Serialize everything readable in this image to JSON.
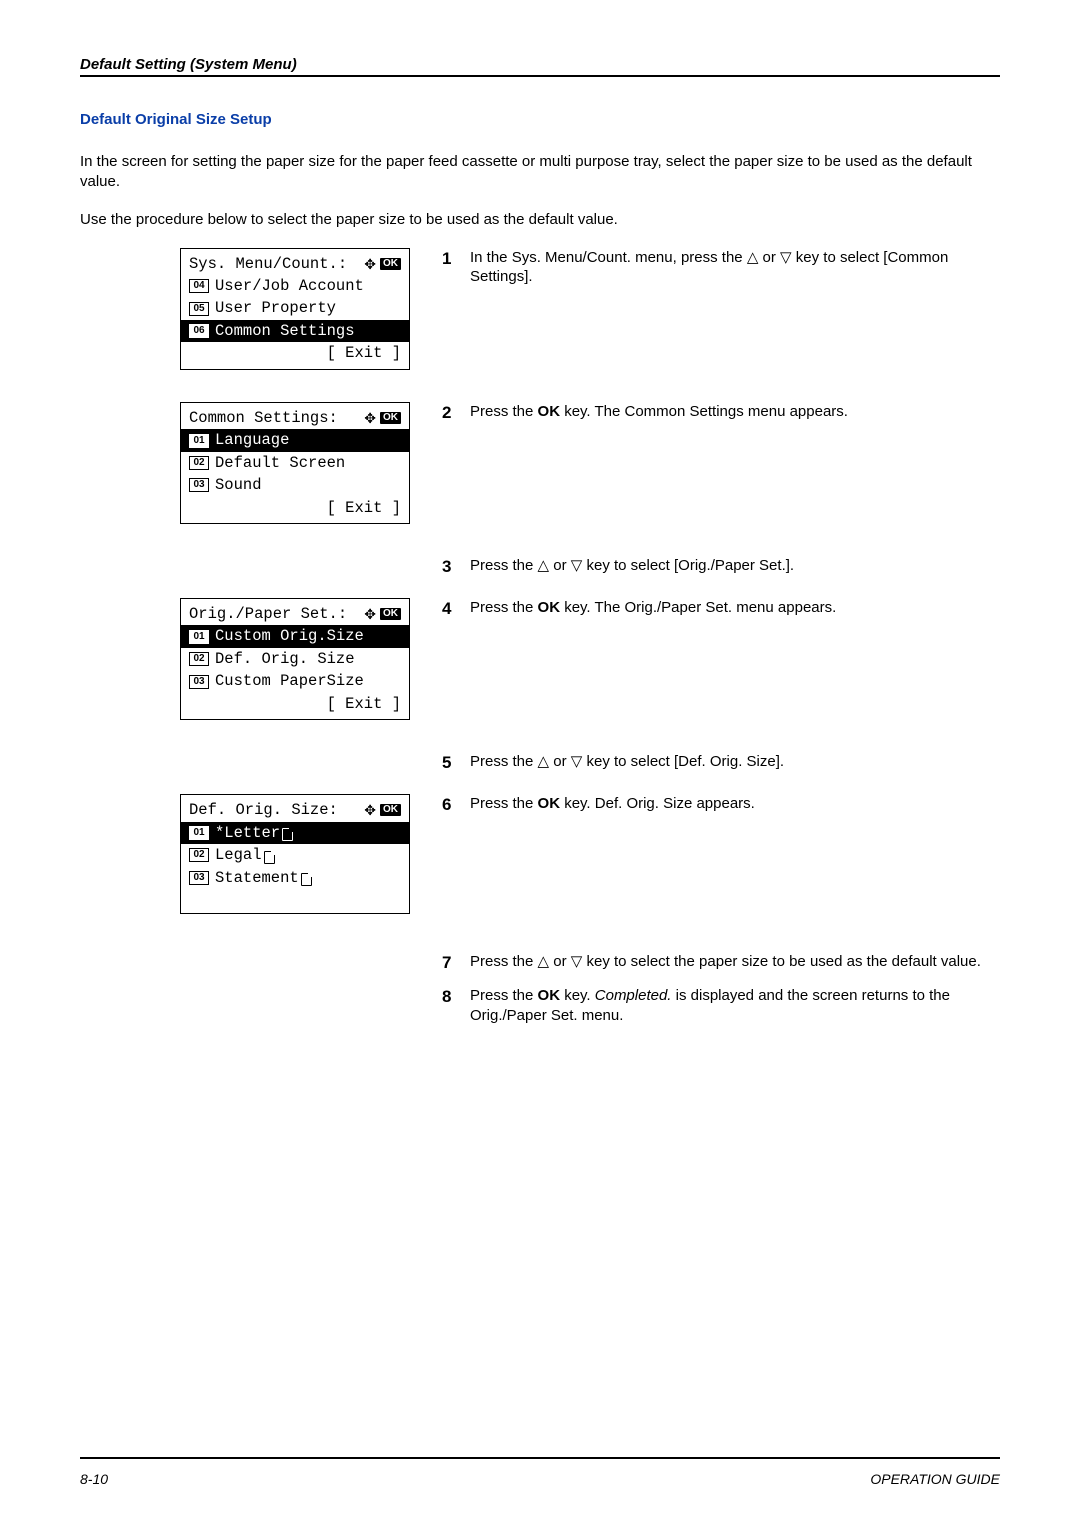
{
  "header": {
    "title": "Default Setting (System Menu)"
  },
  "section": {
    "title": "Default Original Size Setup",
    "intro": "In the screen for setting the paper size for the paper feed cassette or multi purpose tray, select the paper size to be used as the default value.",
    "sub_intro": "Use the procedure below to select the paper size to be used as the default value."
  },
  "icons": {
    "ok": "OK",
    "nav": "✥"
  },
  "lcd1": {
    "title": "Sys. Menu/Count.:",
    "items": [
      {
        "num": "04",
        "label": "User/Job Account",
        "selected": false
      },
      {
        "num": "05",
        "label": "User Property",
        "selected": false
      },
      {
        "num": "06",
        "label": "Common Settings",
        "selected": true
      }
    ],
    "footer": "[  Exit   ]"
  },
  "lcd2": {
    "title": "Common Settings:",
    "items": [
      {
        "num": "01",
        "label": "Language",
        "selected": true
      },
      {
        "num": "02",
        "label": "Default Screen",
        "selected": false
      },
      {
        "num": "03",
        "label": "Sound",
        "selected": false
      }
    ],
    "footer": "[  Exit   ]"
  },
  "lcd3": {
    "title": "Orig./Paper Set.:",
    "items": [
      {
        "num": "01",
        "label": "Custom Orig.Size",
        "selected": true
      },
      {
        "num": "02",
        "label": "Def. Orig. Size",
        "selected": false
      },
      {
        "num": "03",
        "label": "Custom PaperSize",
        "selected": false
      }
    ],
    "footer": "[  Exit   ]"
  },
  "lcd4": {
    "title": "Def. Orig. Size:",
    "items": [
      {
        "num": "01",
        "label": "*Letter",
        "doc": true,
        "selected": true
      },
      {
        "num": "02",
        "label": "Legal",
        "doc": true,
        "selected": false
      },
      {
        "num": "03",
        "label": "Statement",
        "doc": true,
        "selected": false
      }
    ]
  },
  "steps": {
    "s1a": "In the Sys. Menu/Count. menu, press the ",
    "s1b": " or ",
    "s1c": " key to select [Common Settings].",
    "s2a": "Press the ",
    "s2ok": "OK",
    "s2b": " key. The Common Settings menu appears.",
    "s3a": "Press the ",
    "s3b": " or ",
    "s3c": " key to select [Orig./Paper Set.].",
    "s4a": "Press the ",
    "s4ok": "OK",
    "s4b": " key. The Orig./Paper Set. menu appears.",
    "s5a": "Press the ",
    "s5b": " or ",
    "s5c": " key to select [Def. Orig. Size].",
    "s6a": "Press the ",
    "s6ok": "OK",
    "s6b": " key. Def. Orig. Size appears.",
    "s7a": "Press the ",
    "s7b": " or ",
    "s7c": " key to select the paper size to be used as the default value.",
    "s8a": "Press the ",
    "s8ok": "OK",
    "s8b": " key. ",
    "s8i": "Completed.",
    "s8c": " is displayed and the screen returns to the Orig./Paper Set. menu."
  },
  "footer": {
    "page": "8-10",
    "guide": "OPERATION GUIDE"
  }
}
